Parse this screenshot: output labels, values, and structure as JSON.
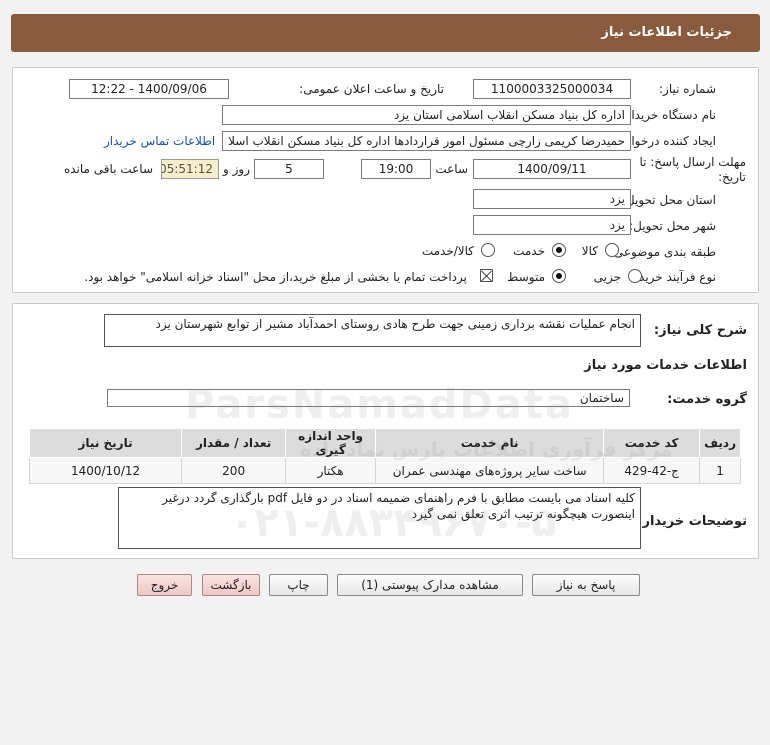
{
  "header": {
    "title": "جزئیات اطلاعات نیاز"
  },
  "details": {
    "need_number_label": "شماره نیاز:",
    "need_number": "1100003325000034",
    "announce_label": "تاریخ و ساعت اعلان عمومی:",
    "announce_value": "1400/09/06 - 12:22",
    "buyer_org_label": "نام دستگاه خریدار:",
    "buyer_org": "اداره کل بنیاد مسکن انقلاب اسلامی استان یزد",
    "requester_label": "ایجاد کننده درخواست:",
    "requester": "حمیدرضا کریمی زارچی مسئول امور قراردادها اداره کل بنیاد مسکن انقلاب اسلا",
    "contact_link": "اطلاعات تماس خریدار",
    "deadline_label": "مهلت ارسال پاسخ: تا تاریخ:",
    "deadline_date": "1400/09/11",
    "time_label": "ساعت",
    "deadline_time": "19:00",
    "days_value": "5",
    "days_label": "روز و",
    "remaining_value": "05:51:12",
    "remaining_label": "ساعت باقی مانده",
    "province_label": "استان محل تحویل:",
    "province": "یزد",
    "city_label": "شهر محل تحویل:",
    "city": "یزد",
    "category_label": "طبقه بندی موضوعی:",
    "category_options": [
      "کالا",
      "خدمت",
      "کالا/خدمت"
    ],
    "category_selected": 1,
    "process_label": "نوع فرآیند خرید :",
    "process_options": [
      "جزیی",
      "متوسط"
    ],
    "process_selected": 1,
    "payment_note": "پرداخت تمام یا بخشی از مبلغ خرید،از محل \"اسناد خزانه اسلامی\" خواهد بود."
  },
  "summary": {
    "description_label": "شرح کلی نیاز:",
    "description": "انجام عملیات نقشه برداری زمینی جهت طرح هادی روستای احمدآباد مشیر از توابع شهرستان یزد",
    "services_title": "اطلاعات خدمات مورد نیاز",
    "service_group_label": "گروه خدمت:",
    "service_group": "ساختمان",
    "table": {
      "headers": [
        "ردیف",
        "کد خدمت",
        "نام خدمت",
        "واحد اندازه گیری",
        "تعداد / مقدار",
        "تاریخ نیاز"
      ],
      "rows": [
        [
          "1",
          "ج-42-429",
          "ساخت سایر پروژه‌های مهندسی عمران",
          "هکتار",
          "200",
          "1400/10/12"
        ]
      ]
    },
    "buyer_notes_label": "توضیحات خریدار:",
    "buyer_notes": "کلیه اسناد می بایست مطابق با فرم راهنمای ضمیمه اسناد در دو فایل pdf بارگذاری گردد درغیر اینصورت هیچگونه ترتیب اثری تعلق نمی گیرد"
  },
  "actions": {
    "reply": "پاسخ به نیاز",
    "attachments": "مشاهده مدارک پیوستی (1)",
    "print": "چاپ",
    "back": "بازگشت",
    "exit": "خروج"
  },
  "watermark": {
    "brand": "ParsNamadData",
    "tagline": "مرکز فرآوری اطلاعات پارس نماد داده",
    "phone": "۰۲۱-۸۸۳۴۹۶۷۰-۵"
  }
}
